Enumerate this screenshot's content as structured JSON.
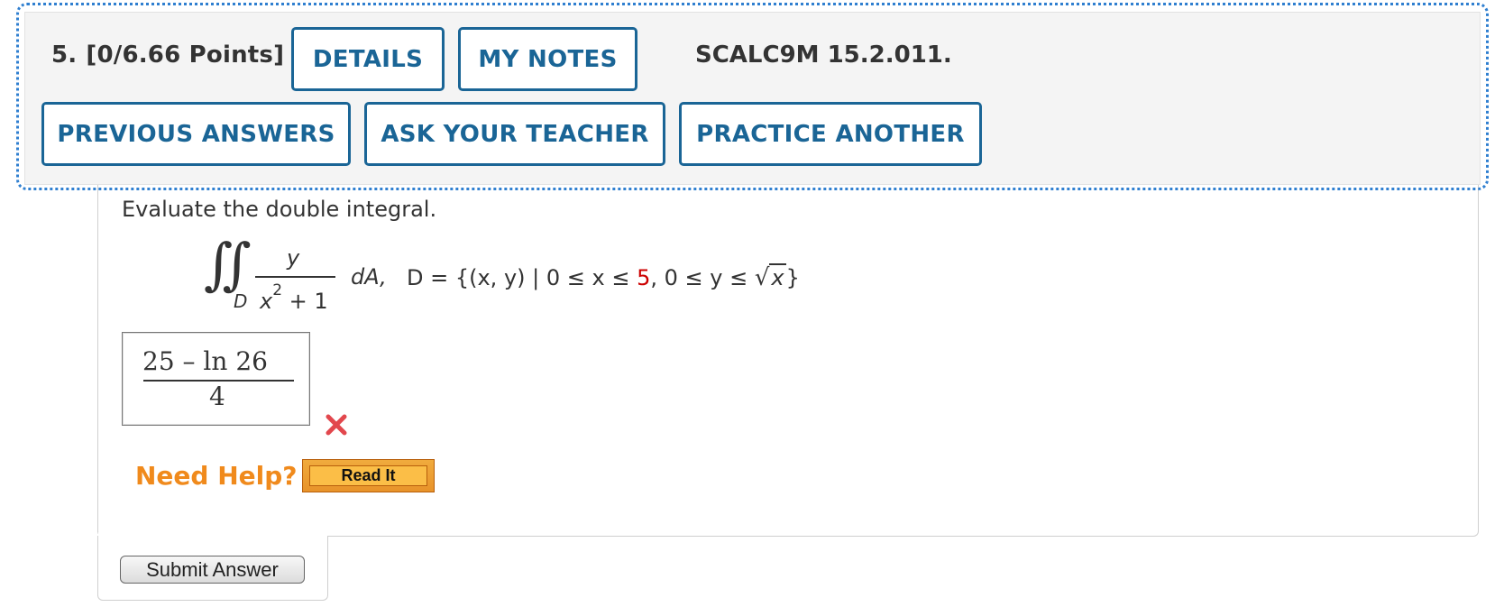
{
  "question": {
    "number": "5.",
    "points": "[0/6.66 Points]",
    "code": "SCALC9M 15.2.011."
  },
  "buttons": {
    "details": "DETAILS",
    "my_notes": "MY NOTES",
    "previous_answers": "PREVIOUS ANSWERS",
    "ask_teacher": "ASK YOUR TEACHER",
    "practice_another": "PRACTICE ANOTHER"
  },
  "problem": {
    "prompt": "Evaluate the double integral.",
    "integral_symbol": "∬",
    "region_subscript": "D",
    "numerator": "y",
    "denominator_var": "x",
    "denominator_exp": "2",
    "denominator_rest": " + 1",
    "differential": "dA,",
    "domain_prefix": "D = {(x, y) | 0 ≤ x ≤ ",
    "domain_bound": "5",
    "domain_mid": ", 0 ≤ y ≤ ",
    "domain_sqrt_var": "x",
    "domain_suffix": "}"
  },
  "answer": {
    "numerator": "25 – ln  26",
    "denominator": "4",
    "status": "incorrect"
  },
  "help": {
    "label": "Need Help?",
    "read_it": "Read It"
  },
  "submit_label": "Submit Answer",
  "colors": {
    "button_blue": "#1a6596",
    "focus_outline": "#2f7fd0",
    "help_orange": "#f08a1c",
    "incorrect_red": "#e2474d",
    "highlight_red": "#cc0000"
  }
}
